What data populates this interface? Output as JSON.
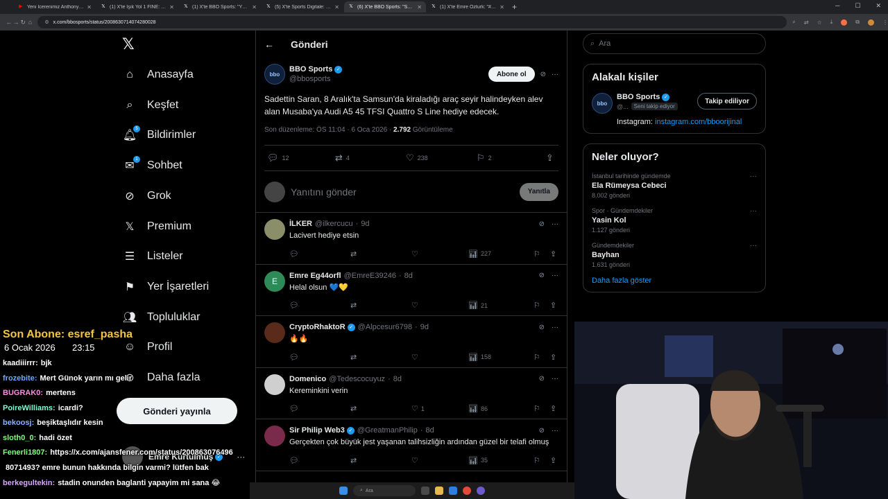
{
  "browser": {
    "tabs": [
      {
        "title": "Yeni İcerenimiz Anthony Mu..",
        "active": false,
        "color": "#ff0000"
      },
      {
        "title": "(1) X'te Işık Yol 1 FINE: \"Yüksel..",
        "active": false,
        "color": "#ffffff"
      },
      {
        "title": "(1) X'te BBO Sports: \"Yüksel Yıl..",
        "active": false,
        "color": "#ffffff"
      },
      {
        "title": "(5) X'te Sports Digitale: \"Şenol..",
        "active": false,
        "color": "#ffffff"
      },
      {
        "title": "(6) X'te BBO Sports: \"Sadettin S..",
        "active": true,
        "color": "#ffffff"
      },
      {
        "title": "(1) X'te Emre Ozturk: \"#SADNEBI..",
        "active": false,
        "color": "#ffffff"
      }
    ],
    "url": "x.com/bbosports/status/2008630714074280028"
  },
  "nav": {
    "items": [
      {
        "label": "Anasayfa",
        "icon": "home-icon",
        "glyph": "⌂"
      },
      {
        "label": "Keşfet",
        "icon": "search-icon",
        "glyph": "⌕"
      },
      {
        "label": "Bildirimler",
        "icon": "bell-icon",
        "glyph": "🔔︎",
        "badge": "5"
      },
      {
        "label": "Sohbet",
        "icon": "mail-icon",
        "glyph": "✉",
        "badge": "1"
      },
      {
        "label": "Grok",
        "icon": "grok-icon",
        "glyph": "⊘"
      },
      {
        "label": "Premium",
        "icon": "x-premium-icon",
        "glyph": "𝕏"
      },
      {
        "label": "Listeler",
        "icon": "list-icon",
        "glyph": "☰"
      },
      {
        "label": "Yer İşaretleri",
        "icon": "bookmark-icon",
        "glyph": "⚑"
      },
      {
        "label": "Topluluklar",
        "icon": "communities-icon",
        "glyph": "👥︎"
      },
      {
        "label": "Profil",
        "icon": "profile-icon",
        "glyph": "☺"
      },
      {
        "label": "Daha fazla",
        "icon": "more-circle-icon",
        "glyph": "⊙"
      }
    ],
    "post_button": "Gönderi yayınla",
    "account_name": "Emre Kurtulmuş"
  },
  "post": {
    "header": "Gönderi",
    "author": "BBO Sports",
    "handle": "@bbosports",
    "subscribe": "Abone ol",
    "text": "Sadettin Saran, 8 Aralık'ta Samsun'da kiraladığı araç seyir halindeyken alev alan Musaba'ya Audi A5 45 TFSI Quattro S Line hediye edecek.",
    "meta": "Son düzenleme: ÖS 11:04 · 6 Oca 2026 · ",
    "views": "2.792",
    "views_label": " Görüntüleme",
    "replies": "12",
    "reposts": "4",
    "likes": "238",
    "bookmarks": "2",
    "reply_placeholder": "Yanıtını gönder",
    "reply_button": "Yanıtla"
  },
  "replies": [
    {
      "name": "İLKER",
      "handle": "@ilkercucu",
      "time": "9d",
      "text": "Lacivert hediye etsin",
      "verified": false,
      "likes": "",
      "views": "227",
      "avatar_color": "#8a8f6a",
      "avatar_letter": ""
    },
    {
      "name": "Emre Eg44orfl",
      "handle": "@EmreE39246",
      "time": "8d",
      "text": "Helal olsun 💙💛",
      "verified": false,
      "likes": "",
      "views": "21",
      "avatar_color": "#2e8b57",
      "avatar_letter": "E"
    },
    {
      "name": "CryptoRhaktoR",
      "handle": "@Alpcesur6798",
      "time": "9d",
      "text": "🔥🔥",
      "verified": true,
      "likes": "",
      "views": "158",
      "avatar_color": "#5a2a1a",
      "avatar_letter": ""
    },
    {
      "name": "Domenico",
      "handle": "@Tedescocuyuz",
      "time": "8d",
      "text": "Kereminkini verin",
      "verified": false,
      "likes": "1",
      "views": "86",
      "avatar_color": "#cfcfcf",
      "avatar_letter": ""
    },
    {
      "name": "Sir Philip Web3",
      "handle": "@GreatmanPhilip",
      "time": "8d",
      "text": "Gerçekten çok büyük jest yaşanan talihsizliğin ardından güzel bir telafi olmuş",
      "verified": true,
      "likes": "",
      "views": "35",
      "avatar_color": "#7a2a4a",
      "avatar_letter": ""
    }
  ],
  "sidebar": {
    "search_placeholder": "Ara",
    "related_title": "Alakalı kişiler",
    "person_name": "BBO Sports",
    "person_handle": "@...",
    "person_chip": "Seni takip ediyor",
    "follow_label": "Takip ediliyor",
    "bio_prefix": "Instagram: ",
    "bio_link": "instagram.com/bboorijinal",
    "trends_title": "Neler oluyor?",
    "trends": [
      {
        "context": "İstanbul tarihinde gündemde",
        "name": "Ela Rümeysa Cebeci",
        "count": "8.002 gönderi"
      },
      {
        "context": "Spor · Gündemdekiler",
        "name": "Yasin Kol",
        "count": "1.127 gönderi"
      },
      {
        "context": "Gündemdekiler",
        "name": "Bayhan",
        "count": "1.631 gönderi"
      }
    ],
    "show_more": "Daha fazla göster"
  },
  "stream": {
    "sub_label": "Son Abone: esref_pasha",
    "date": "6 Ocak 2026",
    "time": "23:15",
    "chat": [
      {
        "user": "kaadiiirrr:",
        "msg": "bjk",
        "color": "#ffffff"
      },
      {
        "user": "frozebite:",
        "msg": "Mert Günok yarın mı gelir",
        "color": "#6fa8ff"
      },
      {
        "user": "BUGRAK0:",
        "msg": "mertens",
        "color": "#ff8de0"
      },
      {
        "user": "PoireWilliams:",
        "msg": "icardi?",
        "color": "#7fffd4"
      },
      {
        "user": "bekoosj:",
        "msg": "beşiktaşlıdır kesin",
        "color": "#8ab4ff"
      },
      {
        "user": "sloth0_0:",
        "msg": "hadi özet",
        "color": "#7fff7f"
      },
      {
        "user": "Fenerli1807:",
        "msg": "https://x.com/ajansfener.com/status/200863076496",
        "color": "#7fff7f"
      },
      {
        "user": "",
        "msg": "8071493? emre bunun hakkında bilgin varmi? lütfen bak",
        "color": "#ffffff"
      },
      {
        "user": "berkegultekin:",
        "msg": "stadin onunden baglanti yapayim mi sana 😂",
        "color": "#d6a8ff"
      }
    ]
  },
  "taskbar": {
    "search": "Ara"
  }
}
